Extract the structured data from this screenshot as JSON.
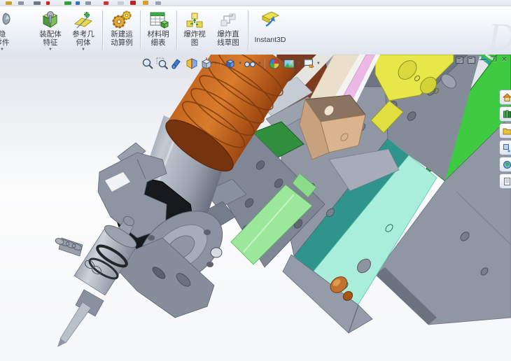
{
  "command_manager": {
    "partial_button": {
      "line1": "隐",
      "line2": "零件"
    },
    "buttons": [
      {
        "id": "assembly-features",
        "line1": "装配体",
        "line2": "特征",
        "has_flyout": true
      },
      {
        "id": "reference-geometry",
        "line1": "参考几",
        "line2": "何体",
        "has_flyout": true
      },
      {
        "id": "new-motion-study",
        "line1": "新建运",
        "line2": "动算例",
        "has_flyout": false
      },
      {
        "id": "bill-of-materials",
        "line1": "材料明",
        "line2": "细表",
        "has_flyout": false
      },
      {
        "id": "exploded-view",
        "line1": "爆炸视",
        "line2": "图",
        "has_flyout": false
      },
      {
        "id": "explode-line-sketch",
        "line1": "爆炸直",
        "line2": "线草图",
        "has_flyout": false
      },
      {
        "id": "instant3d",
        "line1": "Instant3D",
        "line2": "",
        "has_flyout": false
      }
    ],
    "watermark": "D"
  },
  "heads_up_toolbar": {
    "items": [
      "zoom-to-fit",
      "zoom-to-area",
      "previous-view",
      "section-view",
      "view-orientation",
      "display-style",
      "hide-show-items",
      "edit-appearance",
      "apply-scene",
      "view-settings"
    ]
  },
  "window_controls": {
    "minimize_glyph": "—",
    "restore_glyph": "❐",
    "close_glyph": "✕"
  },
  "task_pane": {
    "tabs": [
      "solidworks-resources",
      "design-library",
      "file-explorer",
      "view-palette",
      "appearances-scenes",
      "custom-properties"
    ]
  },
  "viewport": {
    "model_parts": [
      {
        "name": "motor-body",
        "color": "#b45a1c"
      },
      {
        "name": "spindle-cylinder",
        "color": "#9aa3af"
      },
      {
        "name": "clamp-black",
        "color": "#17191d"
      },
      {
        "name": "green-plate",
        "color": "#3ecb42"
      },
      {
        "name": "dark-green-block",
        "color": "#2f8f3c"
      },
      {
        "name": "mint-rail",
        "color": "#9be79b"
      },
      {
        "name": "cyan-strip",
        "color": "#a9eeda"
      },
      {
        "name": "teal-strip",
        "color": "#2f948b"
      },
      {
        "name": "yellow-block",
        "color": "#e7e749"
      },
      {
        "name": "pink-strip",
        "color": "#ecb9e6"
      },
      {
        "name": "cream-strip",
        "color": "#e9dfca"
      },
      {
        "name": "maroon-plate",
        "color": "#7d3c1f"
      },
      {
        "name": "tan-block",
        "color": "#c8a27e"
      },
      {
        "name": "copper-knob",
        "color": "#c1722c"
      },
      {
        "name": "steel-plate",
        "color": "#8f96a4"
      }
    ]
  }
}
